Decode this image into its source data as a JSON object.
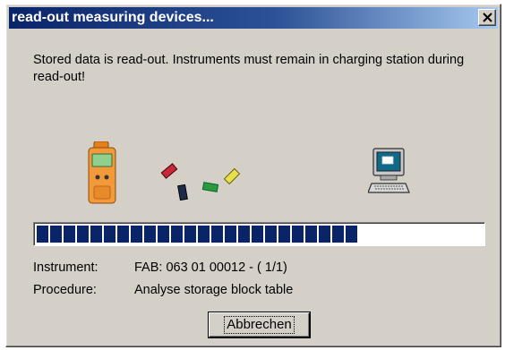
{
  "window": {
    "title": "read-out measuring devices...",
    "close_glyph": "×"
  },
  "message": "Stored data is read-out. Instruments must remain in charging station during read-out!",
  "icons": {
    "device": "gas-detector-icon",
    "transfer": "data-transfer-icon",
    "computer": "computer-icon"
  },
  "progress": {
    "fraction": 0.72
  },
  "info": {
    "instrument_label": "Instrument:",
    "instrument_value": "FAB: 063 01 00012 - ( 1/1)",
    "procedure_label": "Procedure:",
    "procedure_value": "Analyse storage block table"
  },
  "buttons": {
    "cancel_label": "Abbrechen"
  },
  "colors": {
    "title_start": "#0a246a",
    "title_end": "#a6caf0",
    "progress": "#0a246a",
    "face": "#d4d0c8"
  }
}
